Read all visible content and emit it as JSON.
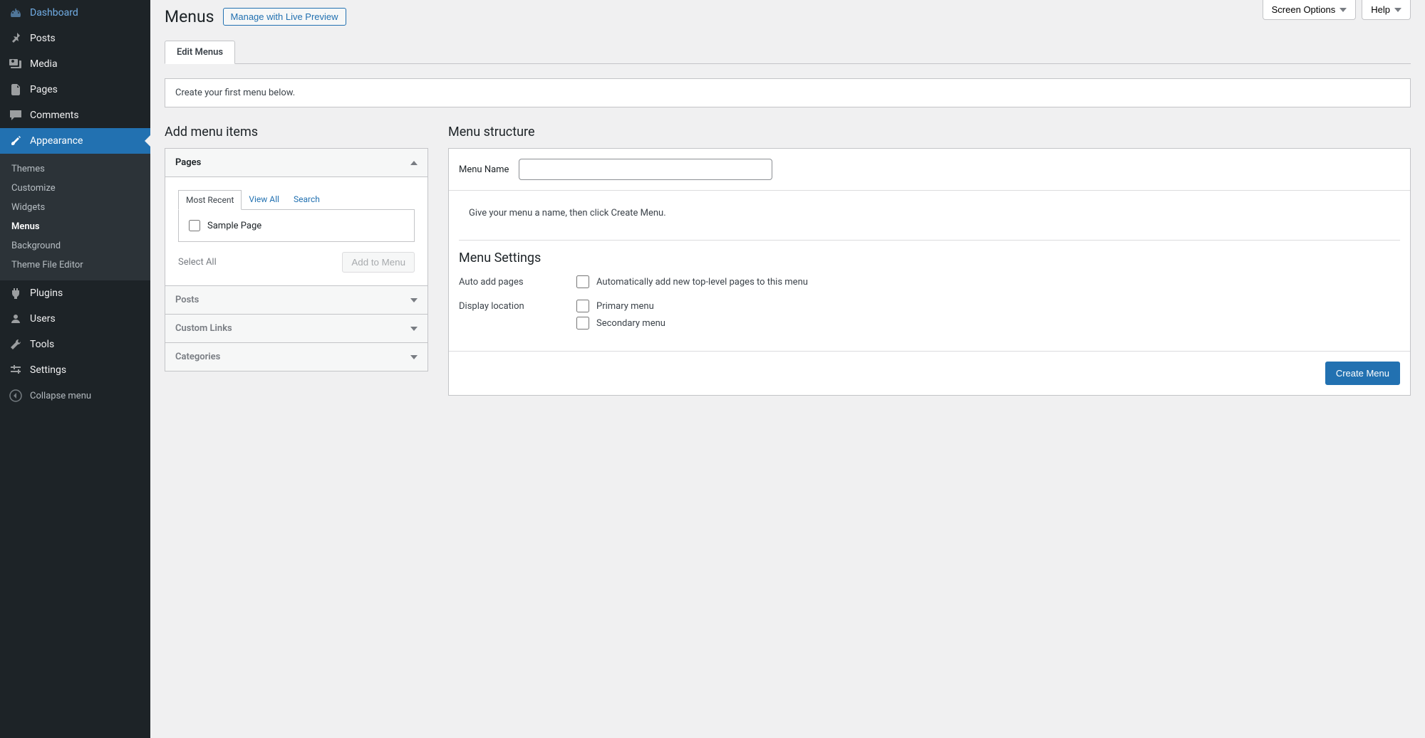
{
  "top_buttons": {
    "screen_options": "Screen Options",
    "help": "Help"
  },
  "sidebar": {
    "items": [
      {
        "label": "Dashboard"
      },
      {
        "label": "Posts"
      },
      {
        "label": "Media"
      },
      {
        "label": "Pages"
      },
      {
        "label": "Comments"
      },
      {
        "label": "Appearance"
      },
      {
        "label": "Plugins"
      },
      {
        "label": "Users"
      },
      {
        "label": "Tools"
      },
      {
        "label": "Settings"
      }
    ],
    "submenu": [
      {
        "label": "Themes"
      },
      {
        "label": "Customize"
      },
      {
        "label": "Widgets"
      },
      {
        "label": "Menus"
      },
      {
        "label": "Background"
      },
      {
        "label": "Theme File Editor"
      }
    ],
    "collapse": "Collapse menu"
  },
  "header": {
    "title": "Menus",
    "live_preview": "Manage with Live Preview"
  },
  "tabs": {
    "edit": "Edit Menus"
  },
  "notice": "Create your first menu below.",
  "add_items": {
    "title": "Add menu items",
    "panels": {
      "pages": "Pages",
      "posts": "Posts",
      "custom_links": "Custom Links",
      "categories": "Categories"
    },
    "inner_tabs": {
      "recent": "Most Recent",
      "view_all": "View All",
      "search": "Search"
    },
    "sample_page": "Sample Page",
    "select_all": "Select All",
    "add_to_menu": "Add to Menu"
  },
  "structure": {
    "title": "Menu structure",
    "name_label": "Menu Name",
    "name_value": "",
    "instruction": "Give your menu a name, then click Create Menu.",
    "settings_title": "Menu Settings",
    "auto_add_label": "Auto add pages",
    "auto_add_text": "Automatically add new top-level pages to this menu",
    "display_label": "Display location",
    "primary": "Primary menu",
    "secondary": "Secondary menu",
    "create_btn": "Create Menu"
  }
}
